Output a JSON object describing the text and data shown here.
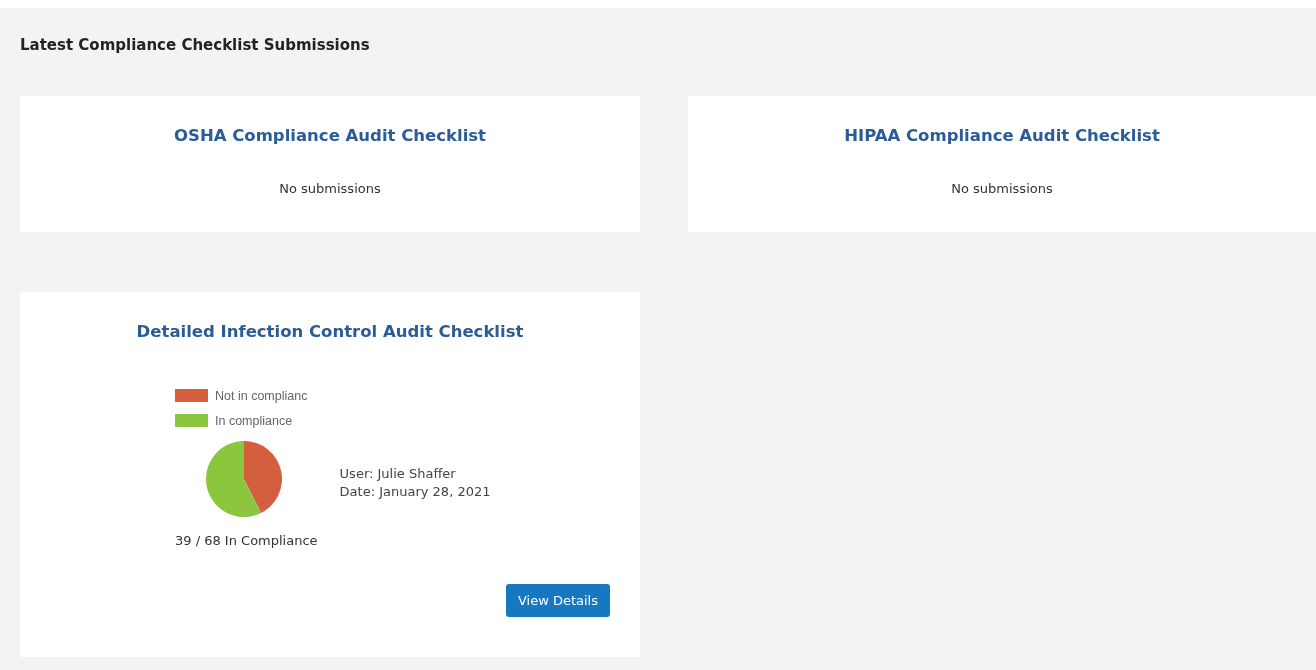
{
  "page": {
    "title": "Latest Compliance Checklist Submissions"
  },
  "cards": [
    {
      "kind": "empty",
      "title": "OSHA Compliance Audit Checklist",
      "message": "No submissions"
    },
    {
      "kind": "empty",
      "title": "HIPAA Compliance Audit Checklist",
      "message": "No submissions"
    },
    {
      "kind": "summary",
      "title": "Detailed Infection Control Audit Checklist",
      "chart_data": {
        "type": "pie",
        "legend": "top",
        "categories": [
          "Not in complianc",
          "In compliance"
        ],
        "series": [
          {
            "colors": [
              "#d35f3f",
              "#8cc63f"
            ],
            "values": [
              42.6,
              57.4
            ]
          }
        ]
      },
      "score": "39 / 68 In Compliance",
      "user": "User: Julie Shaffer",
      "date": "Date: January 28, 2021",
      "button": "View Details"
    }
  ]
}
